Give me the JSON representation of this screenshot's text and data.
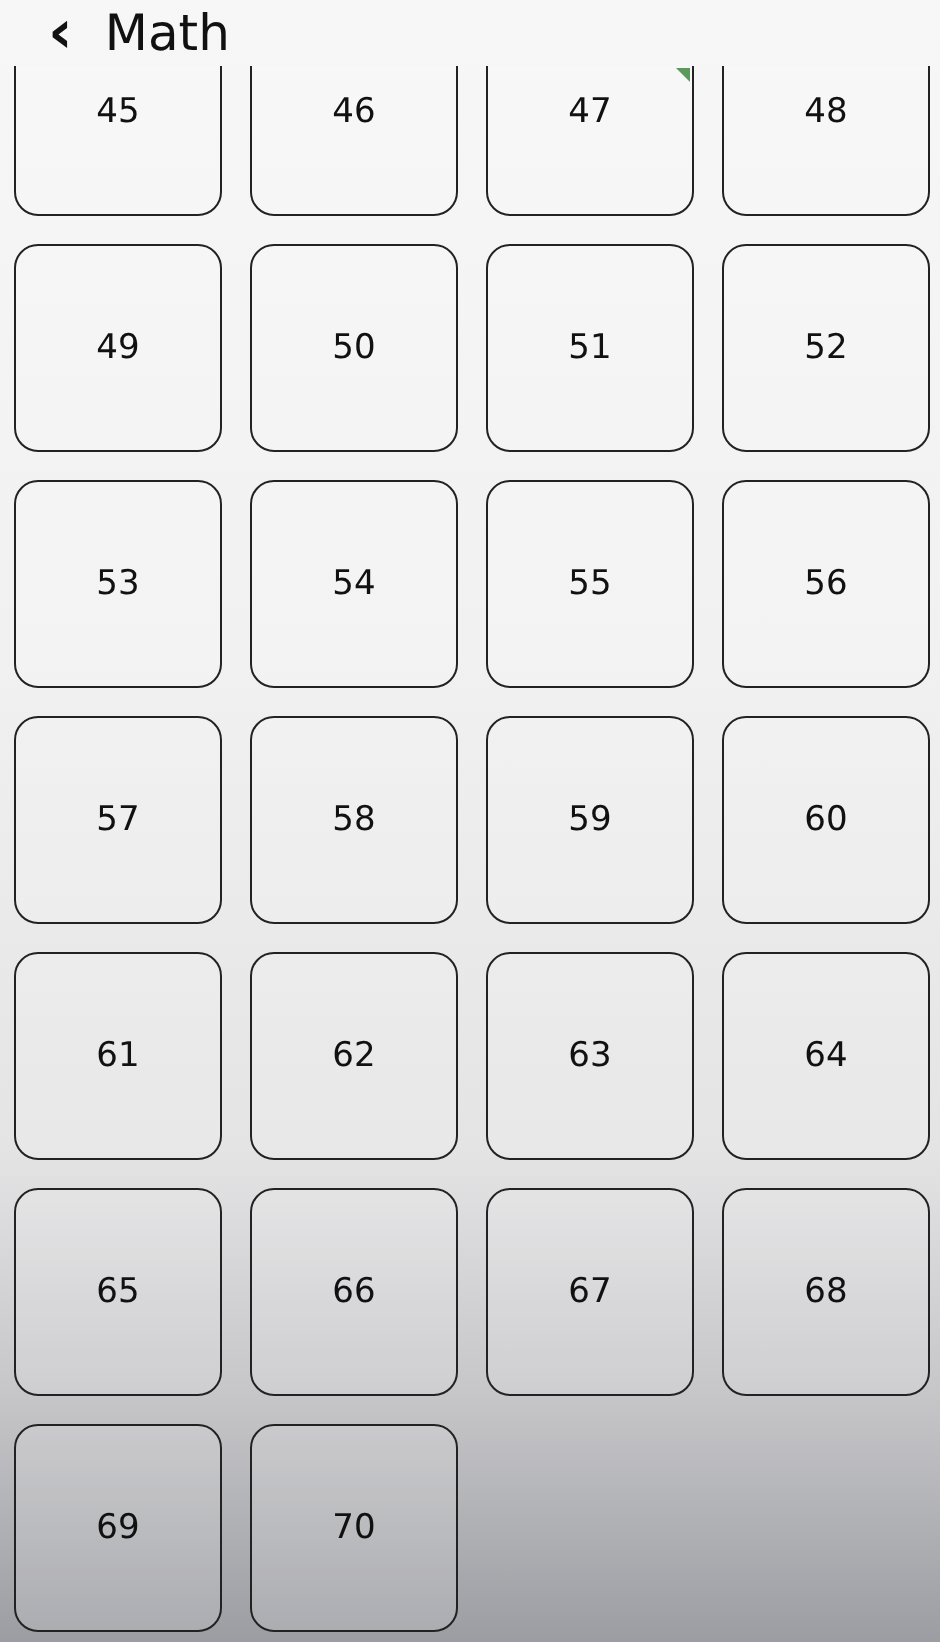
{
  "header": {
    "back": "‹",
    "title": "Math"
  },
  "tiles": [
    {
      "label": "45",
      "done": false
    },
    {
      "label": "46",
      "done": false
    },
    {
      "label": "47",
      "done": true
    },
    {
      "label": "48",
      "done": false
    },
    {
      "label": "49",
      "done": false
    },
    {
      "label": "50",
      "done": false
    },
    {
      "label": "51",
      "done": false
    },
    {
      "label": "52",
      "done": false
    },
    {
      "label": "53",
      "done": false
    },
    {
      "label": "54",
      "done": false
    },
    {
      "label": "55",
      "done": false
    },
    {
      "label": "56",
      "done": false
    },
    {
      "label": "57",
      "done": false
    },
    {
      "label": "58",
      "done": false
    },
    {
      "label": "59",
      "done": false
    },
    {
      "label": "60",
      "done": false
    },
    {
      "label": "61",
      "done": false
    },
    {
      "label": "62",
      "done": false
    },
    {
      "label": "63",
      "done": false
    },
    {
      "label": "64",
      "done": false
    },
    {
      "label": "65",
      "done": false
    },
    {
      "label": "66",
      "done": false
    },
    {
      "label": "67",
      "done": false
    },
    {
      "label": "68",
      "done": false
    },
    {
      "label": "69",
      "done": false
    },
    {
      "label": "70",
      "done": false
    }
  ]
}
